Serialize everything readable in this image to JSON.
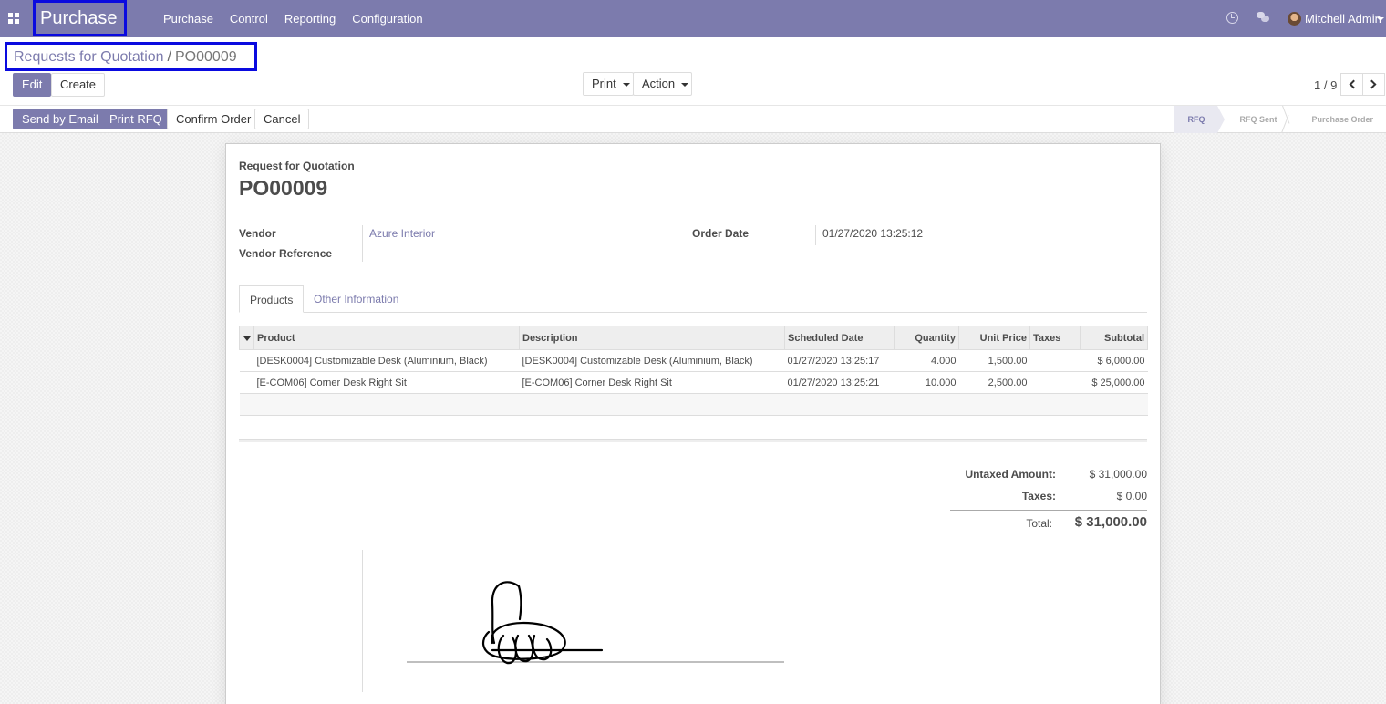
{
  "navbar": {
    "brand": "Purchase",
    "menu": [
      "Purchase",
      "Control",
      "Reporting",
      "Configuration"
    ],
    "user_name": "Mitchell Admin",
    "colors": {
      "primary": "#7c7bad",
      "highlight_box": "#0a0adf"
    }
  },
  "breadcrumb": {
    "parent": "Requests for Quotation",
    "separator": "/",
    "current": "PO00009"
  },
  "control": {
    "edit": "Edit",
    "create": "Create",
    "print": "Print",
    "action": "Action",
    "pager": "1 / 9"
  },
  "header_buttons": {
    "send_email": "Send by Email",
    "print_rfq": "Print RFQ",
    "confirm": "Confirm Order",
    "cancel": "Cancel"
  },
  "statusbar": {
    "stages": [
      "RFQ",
      "RFQ Sent",
      "Purchase Order"
    ],
    "active": "RFQ"
  },
  "form": {
    "doc_type": "Request for Quotation",
    "name": "PO00009",
    "vendor_label": "Vendor",
    "vendor_value": "Azure Interior",
    "vendor_ref_label": "Vendor Reference",
    "vendor_ref_value": "",
    "order_date_label": "Order Date",
    "order_date_value": "01/27/2020 13:25:12"
  },
  "tabs": [
    "Products",
    "Other Information"
  ],
  "lines": {
    "columns": [
      "Product",
      "Description",
      "Scheduled Date",
      "Quantity",
      "Unit Price",
      "Taxes",
      "Subtotal"
    ],
    "rows": [
      {
        "product": "[DESK0004] Customizable Desk (Aluminium, Black)",
        "description": "[DESK0004] Customizable Desk (Aluminium, Black)",
        "date": "01/27/2020 13:25:17",
        "qty": "4.000",
        "price": "1,500.00",
        "taxes": "",
        "subtotal": "$ 6,000.00"
      },
      {
        "product": "[E-COM06] Corner Desk Right Sit",
        "description": "[E-COM06] Corner Desk Right Sit",
        "date": "01/27/2020 13:25:21",
        "qty": "10.000",
        "price": "2,500.00",
        "taxes": "",
        "subtotal": "$ 25,000.00"
      }
    ]
  },
  "totals": {
    "untaxed_label": "Untaxed Amount:",
    "untaxed_value": "$ 31,000.00",
    "taxes_label": "Taxes:",
    "taxes_value": "$ 0.00",
    "total_label": "Total:",
    "total_value": "$ 31,000.00"
  }
}
